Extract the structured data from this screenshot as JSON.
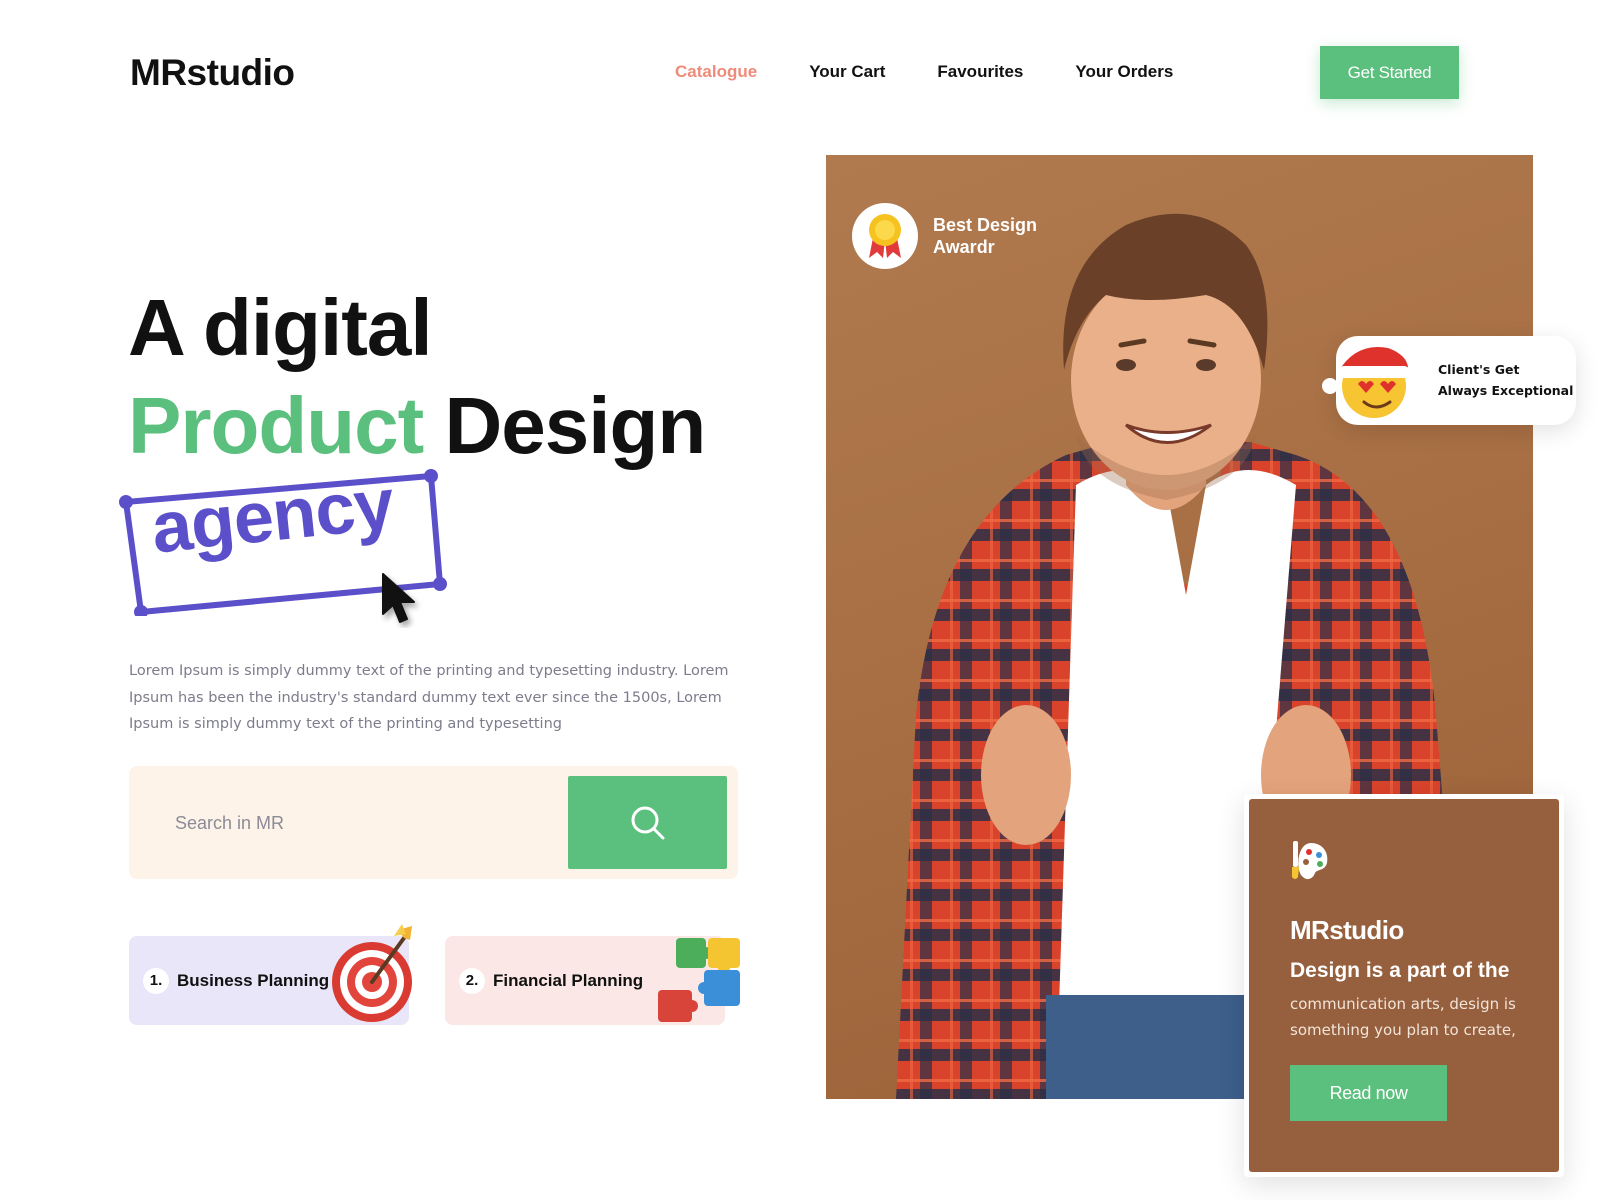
{
  "brand": {
    "logo": "MRstudio"
  },
  "nav": {
    "items": [
      {
        "label": "Catalogue",
        "active": true
      },
      {
        "label": "Your Cart",
        "active": false
      },
      {
        "label": "Favourites",
        "active": false
      },
      {
        "label": "Your Orders",
        "active": false
      }
    ],
    "cta_label": "Get Started"
  },
  "hero": {
    "line1": "A digital",
    "line2_green": "Product",
    "line2_rest": " Design",
    "highlight": "agency",
    "description": "Lorem Ipsum is simply dummy text of the printing and typesetting industry. Lorem Ipsum has been the industry's standard dummy text ever since the 1500s, Lorem Ipsum is simply dummy text of the printing and typesetting"
  },
  "search": {
    "placeholder": "Search in MR",
    "icon": "search-icon"
  },
  "cards": [
    {
      "number": "1.",
      "label": "Business Planning",
      "icon": "target-icon"
    },
    {
      "number": "2.",
      "label": "Financial Planning",
      "icon": "puzzle-icon"
    }
  ],
  "award": {
    "label": "Best Design Awardr",
    "icon": "medal-icon"
  },
  "client_badge": {
    "line1": "Client's Get",
    "line2": "Always Exceptional",
    "icon": "santa-emoji-icon"
  },
  "info_card": {
    "brand": "MRstudio",
    "title": "Design is a part of the",
    "body": "communication arts, design is something you plan to create,",
    "button_label": "Read now",
    "icon": "palette-icon"
  },
  "colors": {
    "accent_green": "#5bbf7d",
    "nav_active": "#ee8b7b",
    "agency_purple": "#5b50c9",
    "info_card_brown": "#965f3d",
    "photo_background": "#a86f44",
    "search_background": "#fdf3e8"
  }
}
